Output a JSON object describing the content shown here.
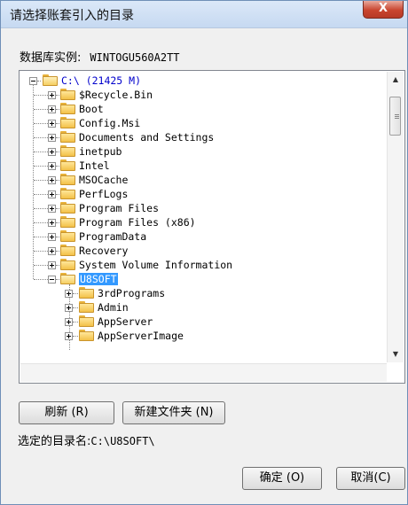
{
  "window": {
    "title": "请选择账套引入的目录",
    "close_glyph": "X"
  },
  "db_instance": {
    "label": "数据库实例:",
    "value": "WINTOGU560A2TT"
  },
  "tree": {
    "root": {
      "label": "C:\\   (21425 M)"
    },
    "items": [
      {
        "label": "$Recycle.Bin"
      },
      {
        "label": "Boot"
      },
      {
        "label": "Config.Msi"
      },
      {
        "label": "Documents and Settings"
      },
      {
        "label": "inetpub"
      },
      {
        "label": "Intel"
      },
      {
        "label": "MSOCache"
      },
      {
        "label": "PerfLogs"
      },
      {
        "label": "Program Files"
      },
      {
        "label": "Program Files (x86)"
      },
      {
        "label": "ProgramData"
      },
      {
        "label": "Recovery"
      },
      {
        "label": "System Volume Information"
      },
      {
        "label": "U8SOFT",
        "selected": true,
        "expanded": true
      }
    ],
    "subitems": [
      {
        "label": "3rdPrograms"
      },
      {
        "label": "Admin"
      },
      {
        "label": "AppServer"
      },
      {
        "label": "AppServerImage"
      }
    ]
  },
  "buttons": {
    "refresh": "刷新 (R)",
    "new_folder": "新建文件夹 (N)",
    "ok": "确定 (O)",
    "cancel": "取消(C)"
  },
  "selected_dir": {
    "label": "选定的目录名:",
    "value": "C:\\U8SOFT\\"
  }
}
